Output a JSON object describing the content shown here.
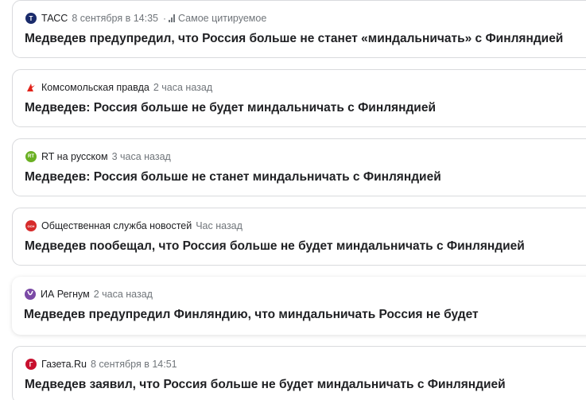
{
  "news_cards": [
    {
      "source": "ТАСС",
      "time": "8 сентября в 14:35",
      "tag": "Самое цитируемое",
      "icon": "tass-logo-icon",
      "icon_color": "#1a2b6b",
      "icon_text": "Т",
      "headline": "Медведев предупредил, что Россия больше не станет «миндальничать» с Финляндией"
    },
    {
      "source": "Комсомольская правда",
      "time": "2 часа назад",
      "icon": "kp-logo-icon",
      "icon_color": "#e2231a",
      "headline": "Медведев: Россия больше не будет миндальничать с Финляндией"
    },
    {
      "source": "RT на русском",
      "time": "3 часа назад",
      "icon": "rt-logo-icon",
      "icon_color": "#6ab023",
      "icon_text": "RT",
      "headline": "Медведев: Россия больше не станет миндальничать с Финляндией"
    },
    {
      "source": "Общественная служба новостей",
      "time": "Час назад",
      "icon": "osn-logo-icon",
      "icon_color": "#d62b2b",
      "icon_text": "ОСН",
      "headline": "Медведев пообещал, что Россия больше не будет миндальничать с Финляндией"
    },
    {
      "source": "ИА Регнум",
      "time": "2 часа назад",
      "icon": "regnum-logo-icon",
      "icon_color": "#7b4aa6",
      "headline": "Медведев предупредил Финляндию, что миндальничать Россия не будет"
    },
    {
      "source": "Газета.Ru",
      "time": "8 сентября в 14:51",
      "icon": "gazeta-logo-icon",
      "icon_color": "#c8102e",
      "icon_text": "Г",
      "headline": "Медведев заявил, что Россия больше не будет миндальничать с Финляндией"
    }
  ]
}
